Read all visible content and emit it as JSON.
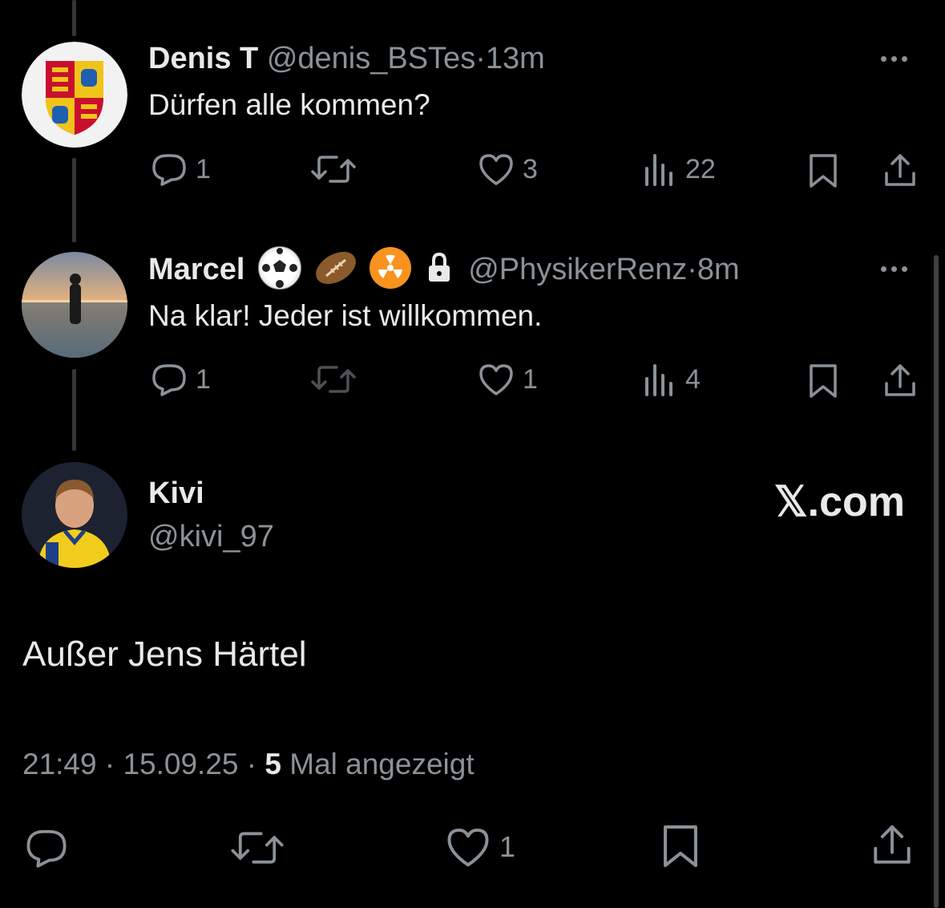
{
  "tweets": [
    {
      "name": "Denis T",
      "handle": "@denis_BSTes",
      "dot": "·",
      "time": "13m",
      "text": "Dürfen alle kommen?",
      "replies": "1",
      "likes": "3",
      "views": "22"
    },
    {
      "name": "Marcel",
      "emojis": [
        "soccer-ball-icon",
        "rugby-ball-icon",
        "radioactive-icon",
        "lock-icon"
      ],
      "handle": "@PhysikerRenz",
      "dot": "·",
      "time": "8m",
      "text": "Na klar! Jeder ist willkommen.",
      "replies": "1",
      "likes": "1",
      "views": "4"
    }
  ],
  "main_tweet": {
    "name": "Kivi",
    "handle": "@kivi_97",
    "watermark": "𝕏.com",
    "text": "Außer Jens Härtel",
    "timestamp": "21:49 · 15.09.25 · ",
    "views_count": "5",
    "views_label": " Mal angezeigt",
    "likes": "1"
  },
  "colors": {
    "background": "#000000",
    "text": "#e7e9ea",
    "secondary": "#8b9197",
    "thread_line": "#333639"
  }
}
